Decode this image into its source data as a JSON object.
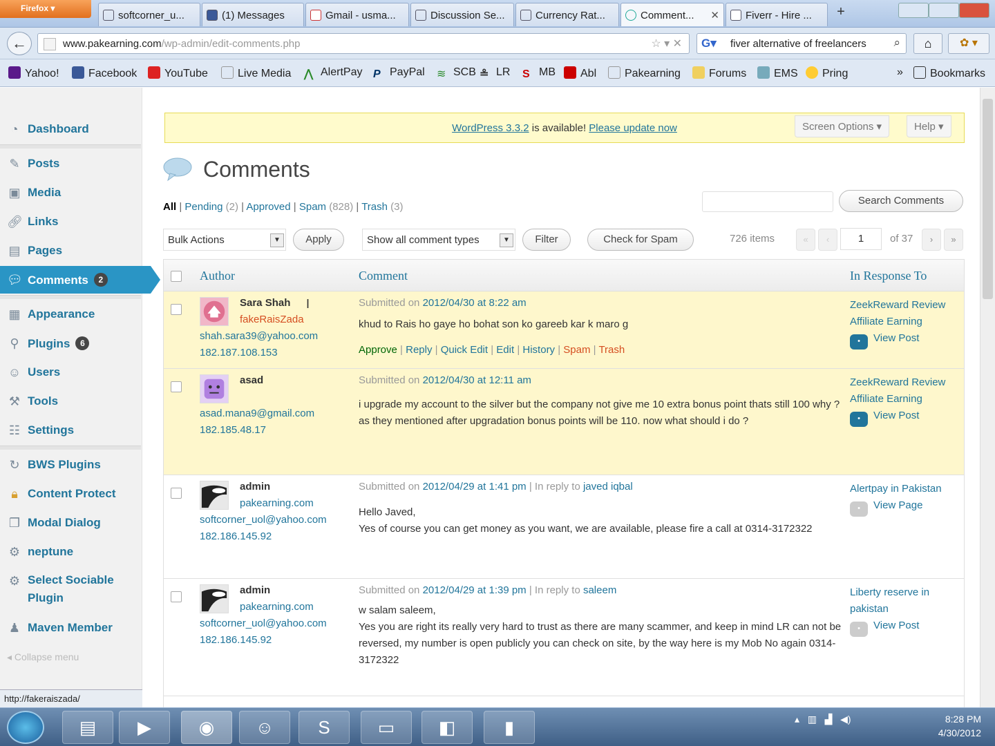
{
  "browser": {
    "menu_label": "Firefox",
    "tabs": [
      {
        "label": "softcorner_u..."
      },
      {
        "label": "(1) Messages"
      },
      {
        "label": "Gmail - usma..."
      },
      {
        "label": "Discussion Se..."
      },
      {
        "label": "Currency Rat..."
      },
      {
        "label": "Comment..."
      },
      {
        "label": "Fiverr - Hire ..."
      }
    ],
    "url_host": "www.pakearning.com",
    "url_path": "/wp-admin/edit-comments.php",
    "search_value": "fiver alternative of freelancers",
    "bookmarks": [
      "Yahoo!",
      "Facebook",
      "YouTube",
      "Live Media",
      "AlertPay",
      "PayPal",
      "SCB",
      "LR",
      "MB",
      "Abl",
      "Pakearning",
      "Forums",
      "EMS",
      "Pring",
      "Bookmarks"
    ],
    "status_url": "http://fakeraiszada/"
  },
  "sidebar": {
    "items": [
      {
        "label": "Dashboard",
        "icon": "dashboard-icon"
      },
      {
        "label": "Posts",
        "icon": "pin-icon"
      },
      {
        "label": "Media",
        "icon": "media-icon"
      },
      {
        "label": "Links",
        "icon": "link-icon"
      },
      {
        "label": "Pages",
        "icon": "page-icon"
      },
      {
        "label": "Comments",
        "icon": "comment-icon",
        "badge": "2"
      },
      {
        "label": "Appearance",
        "icon": "appearance-icon"
      },
      {
        "label": "Plugins",
        "icon": "plugin-icon",
        "badge": "6"
      },
      {
        "label": "Users",
        "icon": "users-icon"
      },
      {
        "label": "Tools",
        "icon": "tools-icon"
      },
      {
        "label": "Settings",
        "icon": "settings-icon"
      },
      {
        "label": "BWS Plugins",
        "icon": "bws-icon"
      },
      {
        "label": "Content Protect",
        "icon": "lock-icon"
      },
      {
        "label": "Modal Dialog",
        "icon": "dialog-icon"
      },
      {
        "label": "neptune",
        "icon": "gear-icon"
      },
      {
        "label": "Select Sociable Plugin",
        "icon": "gear-icon"
      },
      {
        "label": "Maven Member",
        "icon": "member-icon"
      }
    ],
    "collapse_label": "Collapse menu"
  },
  "notice": {
    "link": "WordPress 3.3.2",
    "text": " is available! ",
    "update": "Please update now"
  },
  "screen_options_label": "Screen Options",
  "help_label": "Help",
  "page_title": "Comments",
  "filters": {
    "all": "All",
    "pending": "Pending",
    "pending_count": "(2)",
    "approved": "Approved",
    "spam": "Spam",
    "spam_count": "(828)",
    "trash": "Trash",
    "trash_count": "(3)"
  },
  "search_button": "Search Comments",
  "toolbar": {
    "bulk_actions": "Bulk Actions",
    "apply": "Apply",
    "comment_types": "Show all comment types",
    "filter": "Filter",
    "check_spam": "Check for Spam",
    "items_count": "726 items",
    "current_page": "1",
    "of_total": "of 37"
  },
  "columns": {
    "author": "Author",
    "comment": "Comment",
    "response": "In Response To"
  },
  "comments": [
    {
      "author": "Sara Shah",
      "url": "fakeRaisZada",
      "email": "shah.sara39@yahoo.com",
      "ip": "182.187.108.153",
      "submitted": "Submitted on ",
      "date": "2012/04/30 at 8:22 am",
      "reply_prefix": "",
      "reply_to": "",
      "text": [
        "khud to Rais ho gaye ho bohat son ko gareeb kar k maro g"
      ],
      "actions": {
        "approve": "Approve",
        "reply": "Reply",
        "quick_edit": "Quick Edit",
        "edit": "Edit",
        "history": "History",
        "spam": "Spam",
        "trash": "Trash"
      },
      "response_title": "ZeekReward Review Affiliate Earning",
      "response_link": "View Post"
    },
    {
      "author": "asad",
      "url": "",
      "email": "asad.mana9@gmail.com",
      "ip": "182.185.48.17",
      "submitted": "Submitted on ",
      "date": "2012/04/30 at 12:11 am",
      "reply_prefix": "",
      "reply_to": "",
      "text": [
        "i upgrade my account to the silver but the company not give me 10 extra bonus point thats still 100 why ? as they mentioned after upgradation bonus points will be 110. now what should i do ?"
      ],
      "response_title": "ZeekReward Review Affiliate Earning",
      "response_link": "View Post"
    },
    {
      "author": "admin",
      "url": "pakearning.com",
      "email": "softcorner_uol@yahoo.com",
      "ip": "182.186.145.92",
      "submitted": "Submitted on ",
      "date": "2012/04/29 at 1:41 pm",
      "reply_prefix": " | In reply to ",
      "reply_to": "javed iqbal",
      "text": [
        "Hello Javed,",
        "Yes of course you can get money as you want, we are available, please fire a call at 0314-3172322"
      ],
      "response_title": "Alertpay in Pakistan",
      "response_link": "View Page"
    },
    {
      "author": "admin",
      "url": "pakearning.com",
      "email": "softcorner_uol@yahoo.com",
      "ip": "182.186.145.92",
      "submitted": "Submitted on ",
      "date": "2012/04/29 at 1:39 pm",
      "reply_prefix": " | In reply to ",
      "reply_to": "saleem",
      "text": [
        "w salam saleem,",
        "Yes you are right its really very hard to trust as there are many scammer, and keep in mind LR can not be reversed, my number is open publicly you can check on site, by the way here is my Mob No again 0314-3172322"
      ],
      "response_title": "Liberty reserve in pakistan",
      "response_link": "View Post"
    }
  ],
  "taskbar": {
    "time": "8:28 PM",
    "date": "4/30/2012"
  },
  "colors": {
    "wp_link": "#21759b",
    "menu_current": "#2a95c5",
    "pending_row": "#fef7cc",
    "notice_bg": "#fffbcc"
  }
}
